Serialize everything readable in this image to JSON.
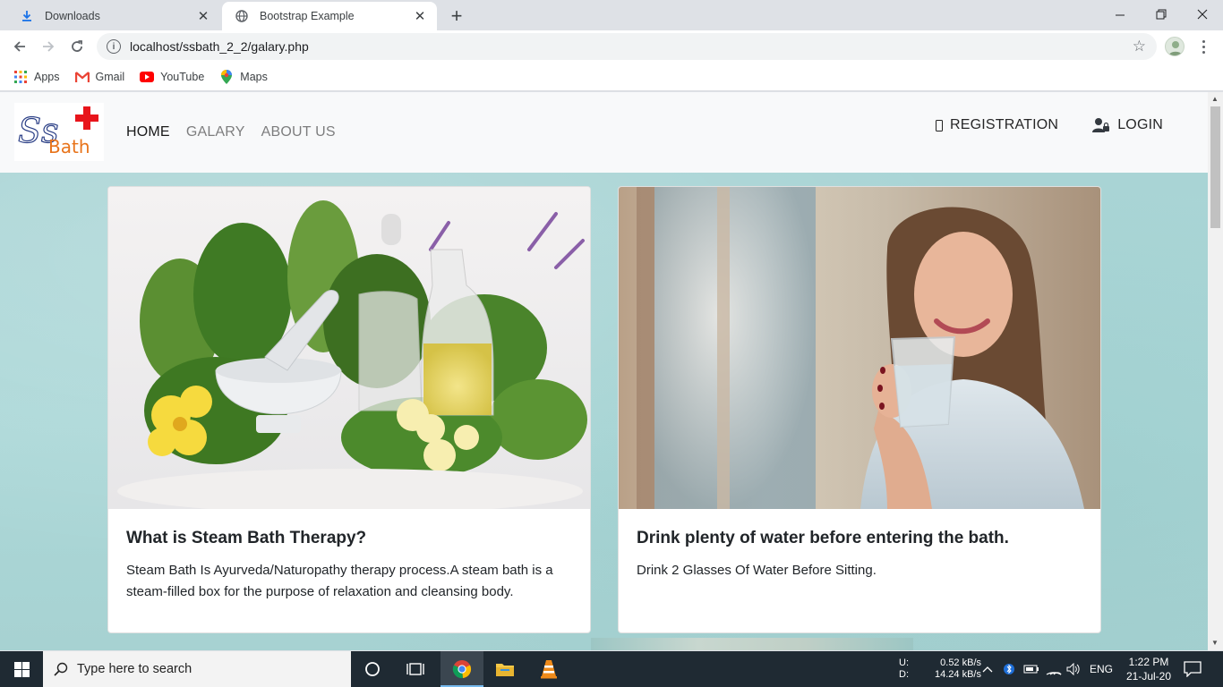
{
  "browser": {
    "tabs": [
      {
        "title": "Downloads",
        "icon": "download-icon",
        "active": false
      },
      {
        "title": "Bootstrap Example",
        "icon": "globe-icon",
        "active": true
      }
    ],
    "new_tab_symbol": "+",
    "url": "localhost/ssbath_2_2/galary.php",
    "bookmarks": [
      {
        "label": "Apps",
        "icon": "apps-grid-icon"
      },
      {
        "label": "Gmail",
        "icon": "gmail-icon"
      },
      {
        "label": "YouTube",
        "icon": "youtube-icon"
      },
      {
        "label": "Maps",
        "icon": "maps-pin-icon"
      }
    ]
  },
  "site": {
    "logo_text_top": "Ss",
    "logo_text_bottom": "Bath",
    "nav": [
      {
        "label": "HOME",
        "active": true
      },
      {
        "label": "GALARY",
        "active": false
      },
      {
        "label": "ABOUT US",
        "active": false
      }
    ],
    "nav_right": [
      {
        "label": "REGISTRATION",
        "icon": "phone-icon"
      },
      {
        "label": "LOGIN",
        "icon": "user-lock-icon"
      }
    ],
    "cards": [
      {
        "title": "What is Steam Bath Therapy?",
        "text": "Steam Bath Is Ayurveda/Naturopathy therapy process.A steam bath is a steam-filled box for the purpose of relaxation and cleansing body.",
        "image": "herbs-mortar-oil-bottles-photo"
      },
      {
        "title": "Drink plenty of water before entering the bath.",
        "text": "Drink 2 Glasses Of Water Before Sitting.",
        "image": "woman-holding-water-glass-photo"
      }
    ]
  },
  "taskbar": {
    "search_placeholder": "Type here to search",
    "net_up_label": "U:",
    "net_down_label": "D:",
    "net_up": "0.52 kB/s",
    "net_down": "14.24 kB/s",
    "language": "ENG",
    "time": "1:22 PM",
    "date": "21-Jul-20"
  },
  "colors": {
    "page_background": "#a9d6d6",
    "navbar_background": "#f8f9fa",
    "logo_cross": "#e8141b",
    "taskbar": "#1f2a33"
  }
}
